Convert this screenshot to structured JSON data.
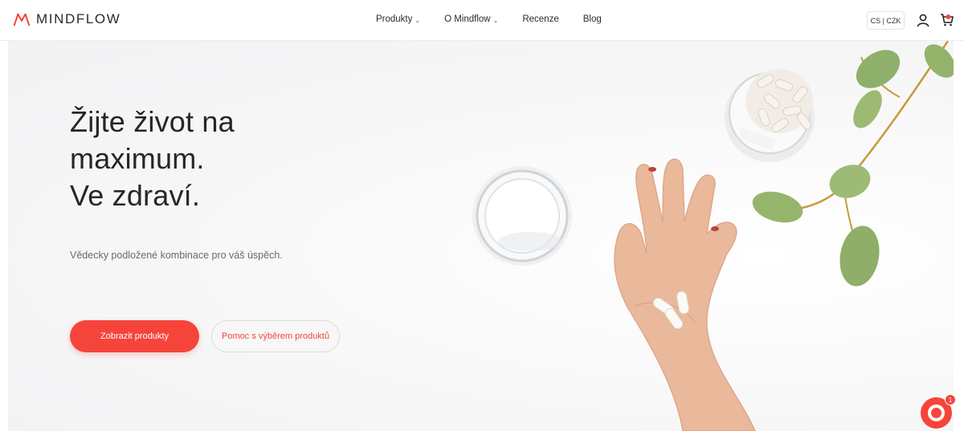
{
  "brand": {
    "name": "MINDFLOW",
    "accent_color": "#f5453b"
  },
  "nav": {
    "items": [
      {
        "label": "Produkty",
        "has_dropdown": true
      },
      {
        "label": "O Mindflow",
        "has_dropdown": true
      },
      {
        "label": "Recenze",
        "has_dropdown": false
      },
      {
        "label": "Blog",
        "has_dropdown": false
      }
    ],
    "language_currency": "CS | CZK",
    "icons": [
      "account-icon",
      "cart-icon"
    ]
  },
  "hero": {
    "headline_lines": [
      "Žijte život na",
      "maximum.",
      "Ve zdraví."
    ],
    "subtitle": "Vědecky podložené kombinace pro váš úspěch.",
    "primary_button": "Zobrazit produkty",
    "secondary_button": "Pomoc s výběrem produktů"
  },
  "chat": {
    "badge_count": "1",
    "icon": "chat-icon"
  }
}
